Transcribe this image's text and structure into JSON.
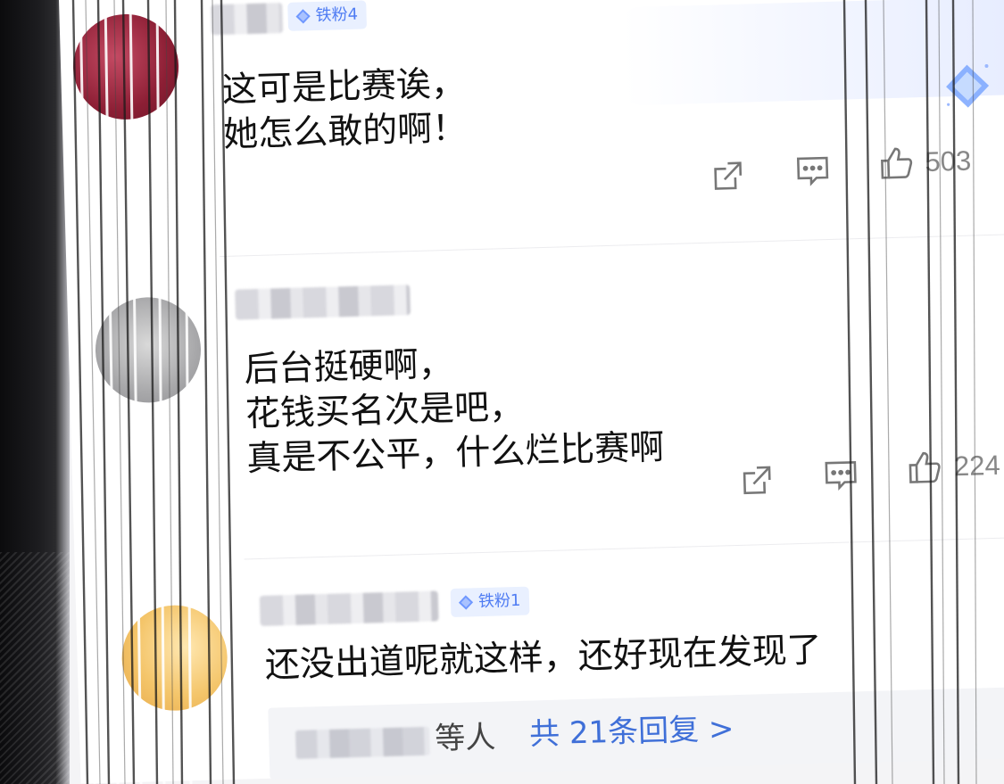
{
  "comments": [
    {
      "badge": "铁粉4",
      "text_lines": [
        "这可是比赛诶，",
        "她怎么敢的啊！"
      ],
      "likes": "503"
    },
    {
      "badge": "",
      "text_lines": [
        "后台挺硬啊，",
        "花钱买名次是吧，",
        "真是不公平，什么烂比赛啊"
      ],
      "likes": "224"
    },
    {
      "badge": "铁粉1",
      "text_lines": [
        "还没出道呢就这样，还好现在发现了"
      ],
      "reply": {
        "suffix": "等人",
        "link": "共 21条回复 >"
      }
    }
  ],
  "colors": {
    "badge_text": "#4f7cf3",
    "badge_bg": "#e9f0ff",
    "link": "#3f6fd8",
    "like_count": "#888888"
  },
  "icons": [
    "share-icon",
    "comment-icon",
    "like-icon",
    "diamond-icon"
  ]
}
